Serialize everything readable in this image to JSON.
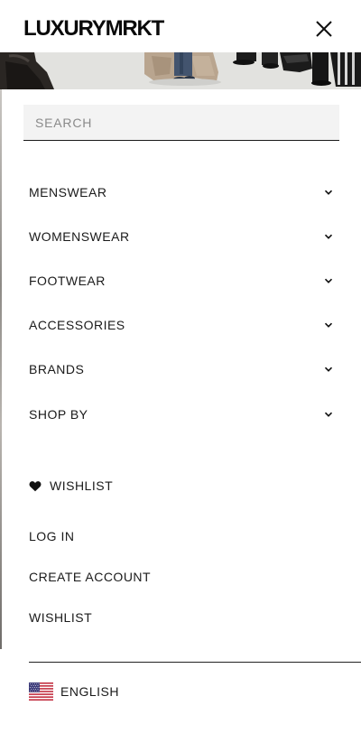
{
  "header": {
    "logo_text": "LUXURYMRKT",
    "close_icon": "close-icon"
  },
  "hero": {
    "image": "runway-photo-strip"
  },
  "search": {
    "placeholder": "SEARCH",
    "value": ""
  },
  "menu": {
    "items": [
      {
        "label": "MENSWEAR",
        "icon": "chevron-down-icon"
      },
      {
        "label": "WOMENSWEAR",
        "icon": "chevron-down-icon"
      },
      {
        "label": "FOOTWEAR",
        "icon": "chevron-down-icon"
      },
      {
        "label": "ACCESSORIES",
        "icon": "chevron-down-icon"
      },
      {
        "label": "BRANDS",
        "icon": "chevron-down-icon"
      },
      {
        "label": "SHOP BY",
        "icon": "chevron-down-icon"
      }
    ]
  },
  "wishlist_heart": {
    "label": "WISHLIST",
    "icon": "heart-icon"
  },
  "account": {
    "login": "LOG IN",
    "create_account": "CREATE ACCOUNT",
    "wishlist": "WISHLIST"
  },
  "language": {
    "label": "ENGLISH",
    "flag_icon": "us-flag-icon"
  },
  "colors": {
    "text": "#1a1a1a",
    "search_bg": "#f3f3f3",
    "background": "#ffffff"
  }
}
